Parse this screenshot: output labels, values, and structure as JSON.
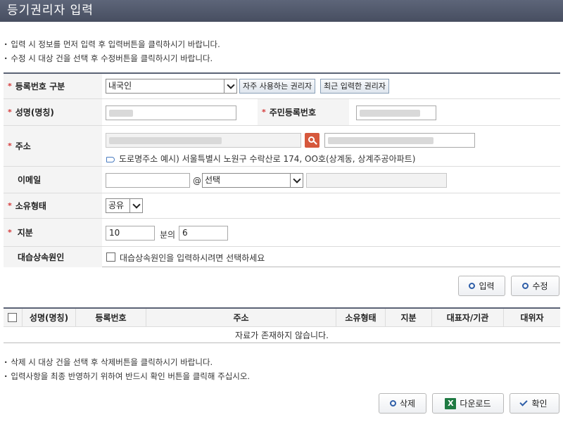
{
  "title": "등기권리자 입력",
  "notes_top": [
    "입력 시 정보를 먼저 입력 후 입력버튼을 클릭하시기 바랍니다.",
    "수정 시 대상 건을 선택 후 수정버튼을 클릭하시기 바랍니다."
  ],
  "form": {
    "reg_type": {
      "label": "등록번호 구분",
      "value": "내국인",
      "btn_frequent": "자주 사용하는 권리자",
      "btn_recent": "최근 입력한 권리자"
    },
    "name": {
      "label": "성명(명칭)",
      "value": ""
    },
    "rrn": {
      "label": "주민등록번호",
      "value": ""
    },
    "address": {
      "label": "주소",
      "value": "",
      "detail": "",
      "hint": "도로명주소 예시) 서울특별시 노원구 수락산로 174, OO호(상계동, 상계주공아파트)"
    },
    "email": {
      "label": "이메일",
      "local": "",
      "at": "@",
      "domain_select": "선택",
      "domain": ""
    },
    "ownership": {
      "label": "소유형태",
      "value": "공유"
    },
    "share": {
      "label": "지분",
      "numerator": "10",
      "middle": "분의",
      "denominator": "6"
    },
    "subrogation": {
      "label": "대습상속원인",
      "checkbox_label": "대습상속원인을 입력하시려면 선택하세요"
    }
  },
  "actions": {
    "input": "입력",
    "edit": "수정"
  },
  "table": {
    "columns": [
      "성명(명칭)",
      "등록번호",
      "주소",
      "소유형태",
      "지분",
      "대표자/기관",
      "대위자"
    ],
    "empty": "자료가 존재하지 않습니다."
  },
  "notes_bottom": [
    "삭제 시 대상 건을 선택 후 삭제버튼을 클릭하시기 바랍니다.",
    "입력사항을 최종 반영하기 위하여 반드시 확인 버튼을 클릭해 주십시오."
  ],
  "footer": {
    "delete": "삭제",
    "download": "다운로드",
    "confirm": "확인",
    "excel_glyph": "X"
  },
  "colors": {
    "header_bg": "#4f5668",
    "required": "#d43a3a",
    "search_btn": "#d6583c",
    "accent": "#2e5ea8"
  }
}
